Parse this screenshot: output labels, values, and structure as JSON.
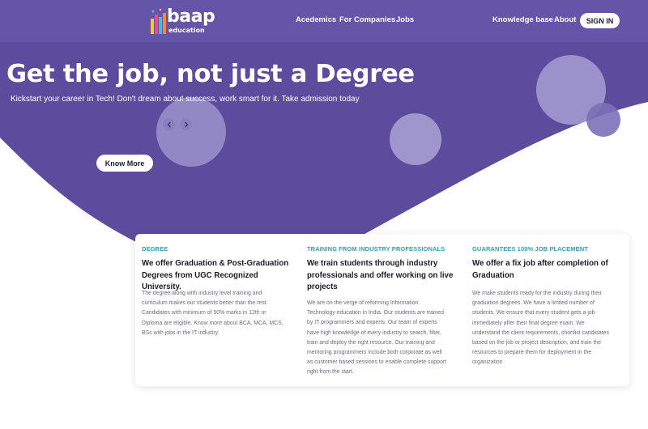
{
  "colors": {
    "hero_purple": "#5b4c9e",
    "nav_purple": "#6455a8",
    "accent_teal": "#26a6b8",
    "circle_light": "#9d93cc"
  },
  "brand": {
    "name": "baap",
    "tagline": "education",
    "logo_icon": "books-icon"
  },
  "nav": {
    "links": [
      "Acedemics",
      "For Companies",
      "Jobs",
      "Knowledge base",
      "About"
    ],
    "signin_label": "SIGN IN"
  },
  "hero": {
    "title": "Get the job, not just a Degree",
    "subtitle": "Kickstart your career in Tech! Don't dream about success, work smart for it. Take admission today",
    "cta_label": "Know More",
    "prev_icon": "chevron-left-icon",
    "next_icon": "chevron-right-icon"
  },
  "features": [
    {
      "tag": "DEGREE",
      "heading": [
        "We offer Graduation & Post-Graduation",
        "Degrees from UGC Recognized University."
      ],
      "body": [
        "The degree along with industry level training and",
        "curriculum makes our students better than the rest.",
        "Candidates with minimum of 50% marks in 12th or",
        "Diploma are eligible. Know more about BCA, MCA, MCS,",
        "BSc with jobs in the IT industry."
      ]
    },
    {
      "tag": "TRAINING FROM INDUSTRY PROFESSIONALS",
      "heading": [
        "We train students through industry",
        "professionals and offer working on live",
        "projects"
      ],
      "body": [
        "We are on the verge of reforming Information",
        "Technology education in India. Our students are trained",
        "by IT programmers and experts. Our team of experts",
        "have high knowledge of every industry to search, filter,",
        "train and deploy the right resource. Our training and",
        "mentoring programmers include both corporate as well",
        "as customer based sessions to enable complete support",
        "right from the start."
      ]
    },
    {
      "tag": "GUARANTEES 100% JOB PLACEMENT",
      "heading": [
        "We offer a fix job after completion of",
        "Graduation"
      ],
      "body": [
        "We make students ready for the industry during their",
        "graduation degrees. We have a limited number of",
        "students. We ensure that every student gets a job",
        "immediately after their final degree exam. We",
        "understand the client requirements, shortlist candidates",
        "based on the job or project description, and train the",
        "resources to prepare them for deployment in the",
        "organization"
      ]
    }
  ]
}
